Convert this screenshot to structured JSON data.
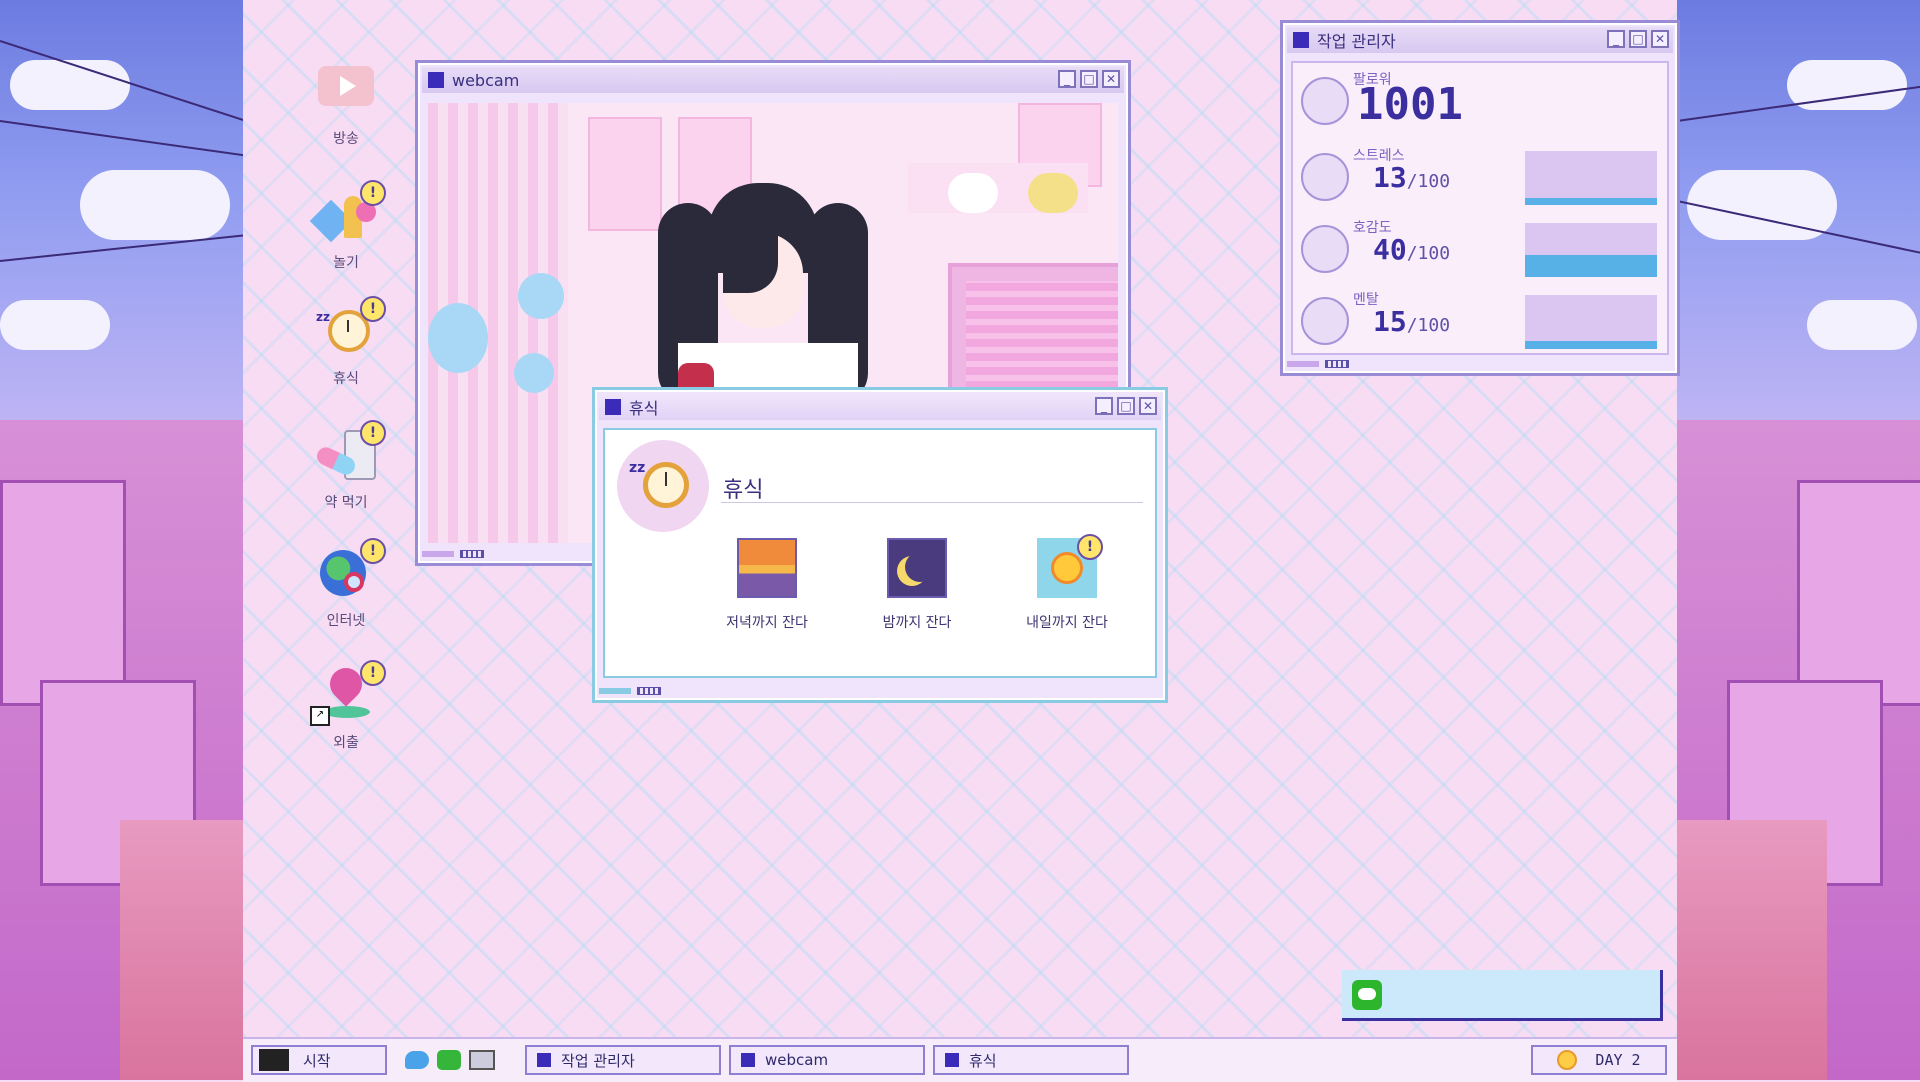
{
  "desktop_icons": [
    {
      "name": "broadcast-icon",
      "label": "방송",
      "badge": ""
    },
    {
      "name": "play-icon",
      "label": "놀기",
      "badge": "!"
    },
    {
      "name": "rest-icon",
      "label": "휴식",
      "badge": "!"
    },
    {
      "name": "medicine-icon",
      "label": "약 먹기",
      "badge": "!"
    },
    {
      "name": "internet-icon",
      "label": "인터넷",
      "badge": "!"
    },
    {
      "name": "outing-icon",
      "label": "외출",
      "badge": "!"
    }
  ],
  "webcam_window": {
    "title": "webcam"
  },
  "rest_window": {
    "title": "휴식",
    "heading": "휴식",
    "options": [
      {
        "label": "저녁까지 잔다",
        "icon": "sunset-icon",
        "badge": ""
      },
      {
        "label": "밤까지 잔다",
        "icon": "moon-icon",
        "badge": ""
      },
      {
        "label": "내일까지 잔다",
        "icon": "sun-icon",
        "badge": "!"
      }
    ]
  },
  "task_manager": {
    "title": "작업 관리자",
    "followers": {
      "label": "팔로워",
      "value": "1001"
    },
    "stats": [
      {
        "label": "스트레스",
        "value": "13",
        "max": "/100",
        "level": 0.13
      },
      {
        "label": "호감도",
        "value": "40",
        "max": "/100",
        "level": 0.4
      },
      {
        "label": "멘탈",
        "value": "15",
        "max": "/100",
        "level": 0.15
      }
    ]
  },
  "taskbar": {
    "start_label": "시작",
    "tasks": [
      "작업 관리자",
      "webcam",
      "휴식"
    ],
    "day_label": "DAY 2"
  },
  "colors": {
    "accent": "#3a2bb8",
    "gauge": "#58b1e6",
    "desktop": "#f7dcf3"
  }
}
